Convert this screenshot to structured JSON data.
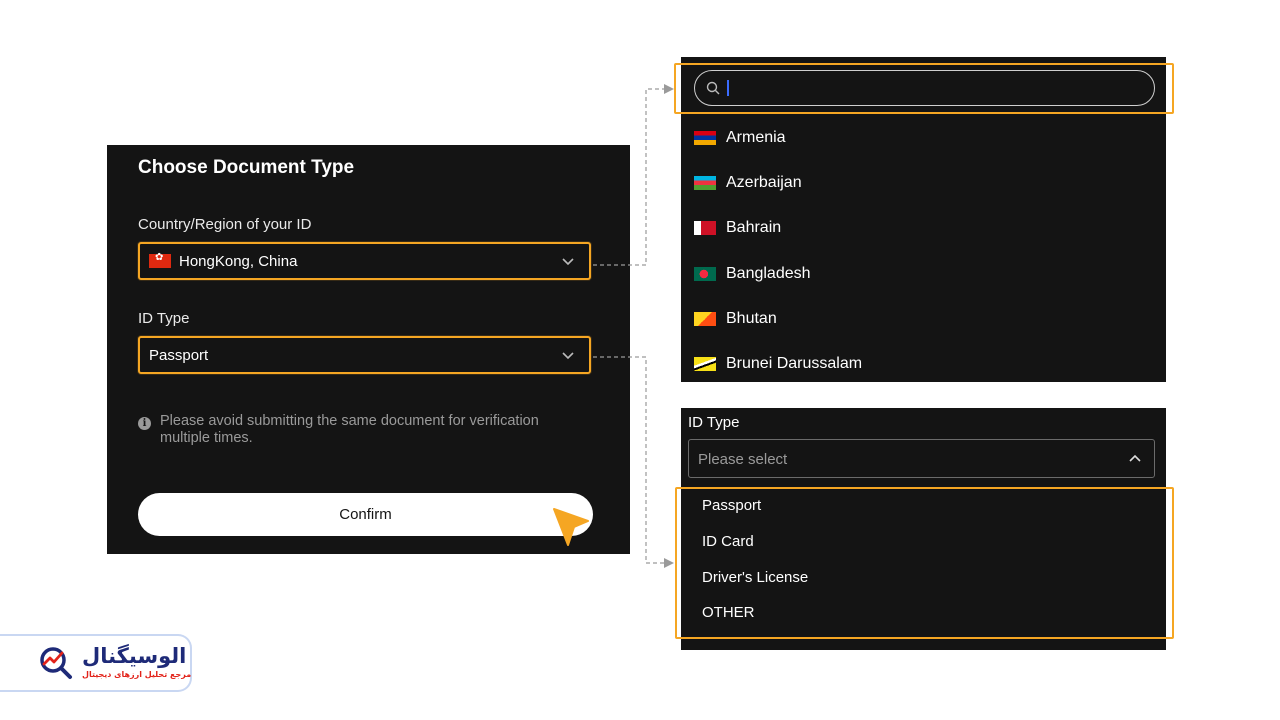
{
  "form": {
    "title": "Choose Document Type",
    "country_label": "Country/Region of your ID",
    "country_value": "HongKong, China",
    "id_type_label": "ID Type",
    "id_type_value": "Passport",
    "notice": "Please avoid submitting the same document for verification multiple times.",
    "confirm_label": "Confirm"
  },
  "country_dropdown": {
    "search_value": "",
    "countries": [
      "Armenia",
      "Azerbaijan",
      "Bahrain",
      "Bangladesh",
      "Bhutan",
      "Brunei Darussalam"
    ]
  },
  "id_dropdown": {
    "label": "ID Type",
    "placeholder": "Please select",
    "options": [
      "Passport",
      "ID Card",
      "Driver's License",
      "OTHER"
    ]
  },
  "logo": {
    "title": "الوسیگنال",
    "subtitle": "مرجع تحلیل ارزهای دیجیتال"
  },
  "colors": {
    "highlight": "#f5a623",
    "panel_bg": "#141414",
    "logo_blue": "#1e2a78",
    "logo_red": "#e2231a"
  }
}
